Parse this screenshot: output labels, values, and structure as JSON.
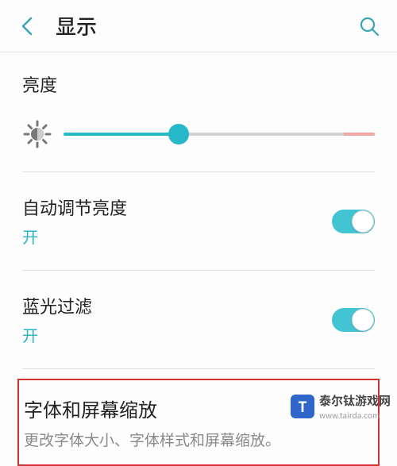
{
  "header": {
    "title": "显示"
  },
  "brightness": {
    "label": "亮度",
    "percent": 37
  },
  "auto_brightness": {
    "title": "自动调节亮度",
    "status": "开",
    "on": true
  },
  "blue_light": {
    "title": "蓝光过滤",
    "status": "开",
    "on": true
  },
  "font_zoom": {
    "title": "字体和屏幕缩放",
    "desc": "更改字体大小、字体样式和屏幕缩放。"
  },
  "watermark": {
    "text": "泰尔钛游戏网",
    "url": "www.tairda.com"
  }
}
